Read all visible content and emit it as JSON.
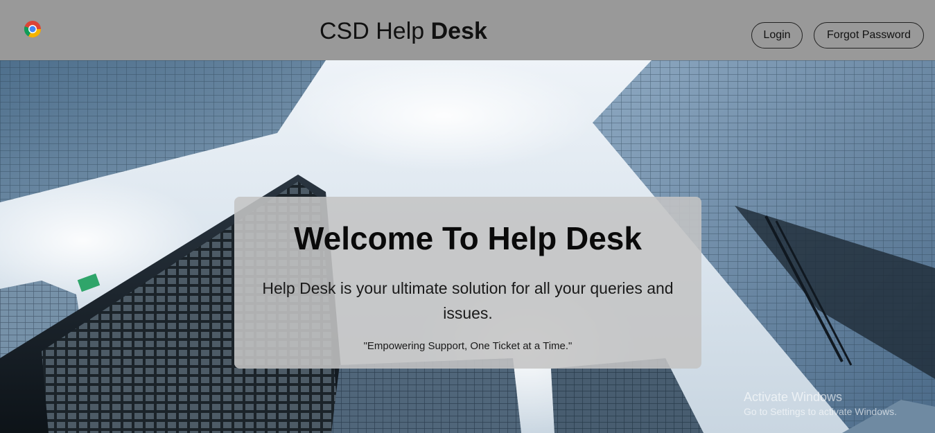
{
  "header": {
    "logo_icon": "chrome-logo-icon",
    "brand_regular": "CSD Help ",
    "brand_bold": "Desk",
    "login_label": "Login",
    "forgot_label": "Forgot Password"
  },
  "hero": {
    "background": "skyscrapers-photo"
  },
  "card": {
    "title": "Welcome To Help Desk",
    "description": "Help Desk is your ultimate solution for all your queries and issues.",
    "quote": "\"Empowering Support, One Ticket at a Time.\""
  },
  "watermark": {
    "title": "Activate Windows",
    "subtitle": "Go to Settings to activate Windows."
  },
  "colors": {
    "header_bg": "#999999",
    "card_bg": "#c4c4c4",
    "text": "#0a0a0a"
  }
}
